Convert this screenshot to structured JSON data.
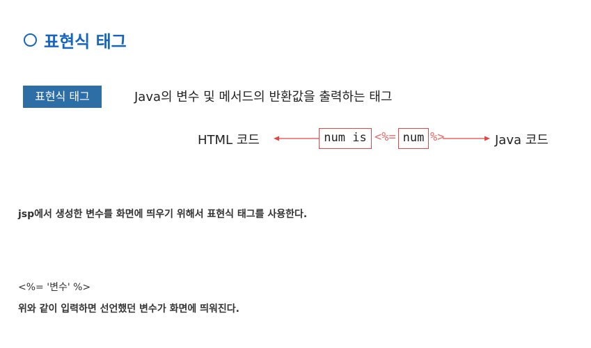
{
  "heading": {
    "text": "표현식 태그"
  },
  "figure": {
    "tag_label": "표현식 태그",
    "description": "Java의 변수 및 메서드의 반환값을 출력하는 태그",
    "diagram": {
      "left_label": "HTML 코드",
      "right_label": "Java 코드",
      "box_left": "num is",
      "open_tag": "<%=",
      "box_right": "num",
      "close_tag": "%>"
    }
  },
  "body": {
    "paragraph1": "jsp에서 생성한 변수를 화면에 띄우기 위해서 표현식 태그를 사용한다.",
    "code_line": "<%= '변수'  %>",
    "paragraph2": "위와 같이 입력하면 선언했던 변수가 화면에 띄워진다."
  },
  "colors": {
    "heading": "#1565c0",
    "tag_box": "#2e6ea7",
    "arrow": "#e04848"
  }
}
